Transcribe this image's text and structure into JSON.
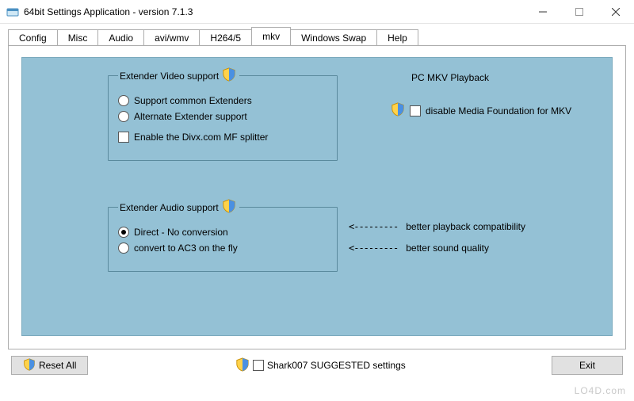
{
  "window": {
    "title": "64bit Settings Application - version 7.1.3"
  },
  "tabs": [
    "Config",
    "Misc",
    "Audio",
    "avi/wmv",
    "H264/5",
    "mkv",
    "Windows Swap",
    "Help"
  ],
  "active_tab_index": 5,
  "video_group": {
    "legend": "Extender Video support",
    "option1": "Support common Extenders",
    "option2": "Alternate Extender support",
    "checkbox": "Enable the Divx.com MF splitter",
    "selected": null,
    "divx_enabled": false
  },
  "pc_mkv": {
    "title": "PC MKV Playback",
    "checkbox": "disable Media Foundation for MKV",
    "checked": false
  },
  "audio_group": {
    "legend": "Extender Audio support",
    "option1": "Direct - No conversion",
    "option2": "convert to AC3 on the fly",
    "selected": 0,
    "note1": "better playback compatibility",
    "note2": "better sound quality",
    "arrow": "<---------"
  },
  "footer": {
    "reset": "Reset All",
    "suggested": "Shark007 SUGGESTED settings",
    "suggested_checked": false,
    "exit": "Exit"
  },
  "watermark": "LO4D.com"
}
